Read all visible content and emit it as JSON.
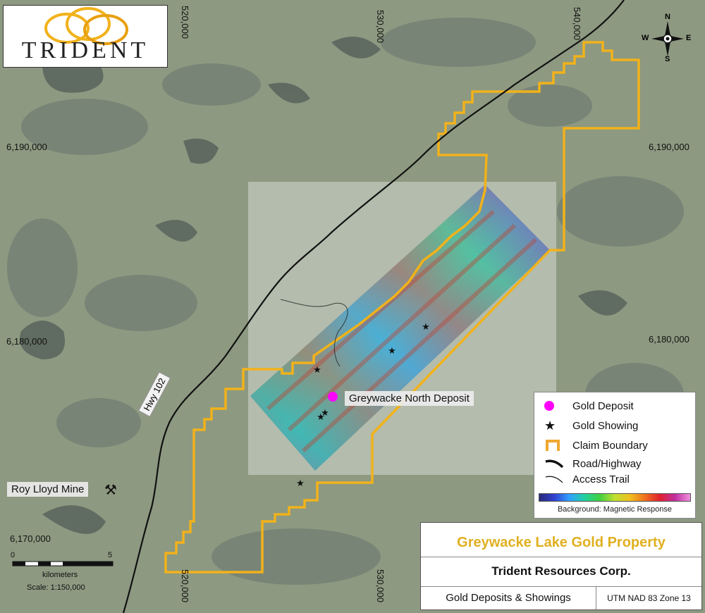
{
  "logo": {
    "text": "TRIDENT",
    "ring_color": "#f2b21a",
    "icon": "rings-logo-icon"
  },
  "grid_labels": {
    "top": [
      "520,000",
      "530,000",
      "540,000"
    ],
    "bottom": [
      "520,000",
      "530,000"
    ],
    "left": [
      "6,190,000",
      "6,180,000",
      "6,170,000"
    ],
    "right": [
      "6,190,000",
      "6,180,000"
    ]
  },
  "map_labels": {
    "deposit": "Greywacke North Deposit",
    "highway": "Hwy 102",
    "mine": "Roy Lloyd Mine",
    "mine_icon": "pick-hammer-icon"
  },
  "compass": {
    "n": "N",
    "s": "S",
    "e": "E",
    "w": "W",
    "icon": "compass-rose-icon"
  },
  "scale_bar": {
    "start": "0",
    "end": "5",
    "unit": "kilometers",
    "scale": "Scale: 1:150,000"
  },
  "legend": {
    "items": [
      {
        "label": "Gold Deposit",
        "icon": "pink-circle-icon",
        "color": "#ff00ff"
      },
      {
        "label": "Gold Showing",
        "icon": "star-icon",
        "color": "#111111"
      },
      {
        "label": "Claim Boundary",
        "icon": "claim-corner-icon",
        "color": "#f0a830"
      },
      {
        "label": "Road/Highway",
        "icon": "thick-line-icon",
        "color": "#111111"
      },
      {
        "label": "Access Trail",
        "icon": "thin-line-icon",
        "color": "#111111"
      }
    ],
    "background_caption": "Background: Magnetic Response"
  },
  "title_block": {
    "property": "Greywacke Lake Gold Property",
    "company": "Trident Resources Corp.",
    "subtitle": "Gold Deposits & Showings",
    "projection": "UTM NAD 83 Zone 13"
  },
  "colors": {
    "claim": "#f2b21a",
    "deposit": "#ff00ff",
    "title": "#e0b020"
  }
}
